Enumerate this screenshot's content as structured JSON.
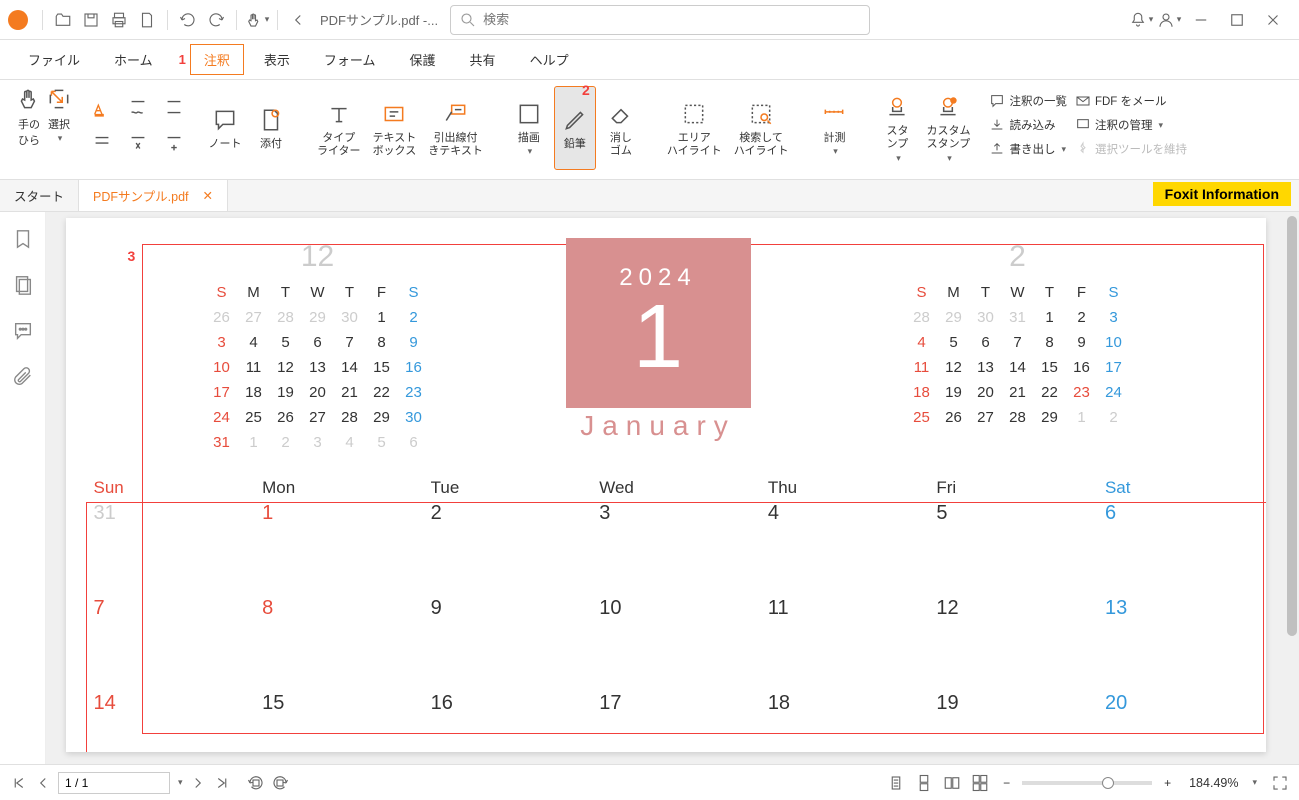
{
  "titlebar": {
    "doc_title": "PDFサンプル.pdf -...",
    "search_placeholder": "検索"
  },
  "menu": {
    "items": [
      "ファイル",
      "ホーム",
      "注釈",
      "表示",
      "フォーム",
      "保護",
      "共有",
      "ヘルプ"
    ],
    "active_index": 2,
    "marker_number": "1"
  },
  "ribbon": {
    "hand": "手の\nひら",
    "select": "選択",
    "note": "ノート",
    "attach": "添付",
    "typewriter": "タイプ\nライター",
    "textbox": "テキスト\nボックス",
    "callout": "引出線付\nきテキスト",
    "draw": "描画",
    "pencil": "鉛筆",
    "eraser": "消し\nゴム",
    "area_hl": "エリア\nハイライト",
    "search_hl": "検索して\nハイライト",
    "measure": "計測",
    "stamp": "スタ\nンプ",
    "custom_stamp": "カスタム\nスタンプ",
    "annot_list": "注釈の一覧",
    "import": "読み込み",
    "export": "書き出し",
    "fdf_mail": "FDF をメール",
    "annot_manage": "注釈の管理",
    "keep_select": "選択ツールを維持",
    "marker_number": "2"
  },
  "tabs": {
    "start": "スタート",
    "doc": "PDFサンプル.pdf"
  },
  "foxit_info": "Foxit  Information",
  "document": {
    "marker_number": "3",
    "big": {
      "year": "2024",
      "month_num": "1",
      "month_name": "January"
    },
    "mini_prev": {
      "title": "12",
      "dow": [
        "S",
        "M",
        "T",
        "W",
        "T",
        "F",
        "S"
      ],
      "rows": [
        [
          {
            "v": "26",
            "m": 1
          },
          {
            "v": "27",
            "m": 1
          },
          {
            "v": "28",
            "m": 1
          },
          {
            "v": "29",
            "m": 1
          },
          {
            "v": "30",
            "m": 1
          },
          {
            "v": "1"
          },
          {
            "v": "2",
            "sat": 1
          }
        ],
        [
          {
            "v": "3",
            "sun": 1
          },
          {
            "v": "4"
          },
          {
            "v": "5"
          },
          {
            "v": "6"
          },
          {
            "v": "7"
          },
          {
            "v": "8"
          },
          {
            "v": "9",
            "sat": 1
          }
        ],
        [
          {
            "v": "10",
            "sun": 1
          },
          {
            "v": "11"
          },
          {
            "v": "12"
          },
          {
            "v": "13"
          },
          {
            "v": "14"
          },
          {
            "v": "15"
          },
          {
            "v": "16",
            "sat": 1
          }
        ],
        [
          {
            "v": "17",
            "sun": 1
          },
          {
            "v": "18"
          },
          {
            "v": "19"
          },
          {
            "v": "20"
          },
          {
            "v": "21"
          },
          {
            "v": "22"
          },
          {
            "v": "23",
            "sat": 1
          }
        ],
        [
          {
            "v": "24",
            "sun": 1
          },
          {
            "v": "25"
          },
          {
            "v": "26"
          },
          {
            "v": "27"
          },
          {
            "v": "28"
          },
          {
            "v": "29"
          },
          {
            "v": "30",
            "sat": 1
          }
        ],
        [
          {
            "v": "31",
            "sun": 1
          },
          {
            "v": "1",
            "m": 1
          },
          {
            "v": "2",
            "m": 1
          },
          {
            "v": "3",
            "m": 1
          },
          {
            "v": "4",
            "m": 1
          },
          {
            "v": "5",
            "m": 1
          },
          {
            "v": "6",
            "m": 1
          }
        ]
      ]
    },
    "mini_next": {
      "title": "2",
      "dow": [
        "S",
        "M",
        "T",
        "W",
        "T",
        "F",
        "S"
      ],
      "rows": [
        [
          {
            "v": "28",
            "m": 1
          },
          {
            "v": "29",
            "m": 1
          },
          {
            "v": "30",
            "m": 1
          },
          {
            "v": "31",
            "m": 1
          },
          {
            "v": "1"
          },
          {
            "v": "2"
          },
          {
            "v": "3",
            "sat": 1
          }
        ],
        [
          {
            "v": "4",
            "sun": 1
          },
          {
            "v": "5"
          },
          {
            "v": "6"
          },
          {
            "v": "7"
          },
          {
            "v": "8"
          },
          {
            "v": "9"
          },
          {
            "v": "10",
            "sat": 1
          }
        ],
        [
          {
            "v": "11",
            "sun": 1
          },
          {
            "v": "12"
          },
          {
            "v": "13"
          },
          {
            "v": "14"
          },
          {
            "v": "15"
          },
          {
            "v": "16"
          },
          {
            "v": "17",
            "sat": 1
          }
        ],
        [
          {
            "v": "18",
            "sun": 1
          },
          {
            "v": "19"
          },
          {
            "v": "20"
          },
          {
            "v": "21"
          },
          {
            "v": "22"
          },
          {
            "v": "23",
            "sun": 1
          },
          {
            "v": "24",
            "sat": 1
          }
        ],
        [
          {
            "v": "25",
            "sun": 1
          },
          {
            "v": "26"
          },
          {
            "v": "27"
          },
          {
            "v": "28"
          },
          {
            "v": "29"
          },
          {
            "v": "1",
            "m": 1
          },
          {
            "v": "2",
            "m": 1
          }
        ]
      ]
    },
    "big_cal": {
      "dow": [
        "Sun",
        "Mon",
        "Tue",
        "Wed",
        "Thu",
        "Fri",
        "Sat"
      ],
      "rows": [
        [
          {
            "v": "31",
            "m": 1
          },
          {
            "v": "1",
            "sun": 1
          },
          {
            "v": "2"
          },
          {
            "v": "3"
          },
          {
            "v": "4"
          },
          {
            "v": "5"
          },
          {
            "v": "6",
            "sat": 1
          }
        ],
        [
          {
            "v": "7",
            "sun": 1
          },
          {
            "v": "8",
            "sun": 1
          },
          {
            "v": "9"
          },
          {
            "v": "10"
          },
          {
            "v": "11"
          },
          {
            "v": "12"
          },
          {
            "v": "13",
            "sat": 1
          }
        ],
        [
          {
            "v": "14",
            "sun": 1
          },
          {
            "v": "15"
          },
          {
            "v": "16"
          },
          {
            "v": "17"
          },
          {
            "v": "18"
          },
          {
            "v": "19"
          },
          {
            "v": "20",
            "sat": 1
          }
        ]
      ]
    }
  },
  "status": {
    "page": "1 / 1",
    "zoom": "184.49%"
  }
}
